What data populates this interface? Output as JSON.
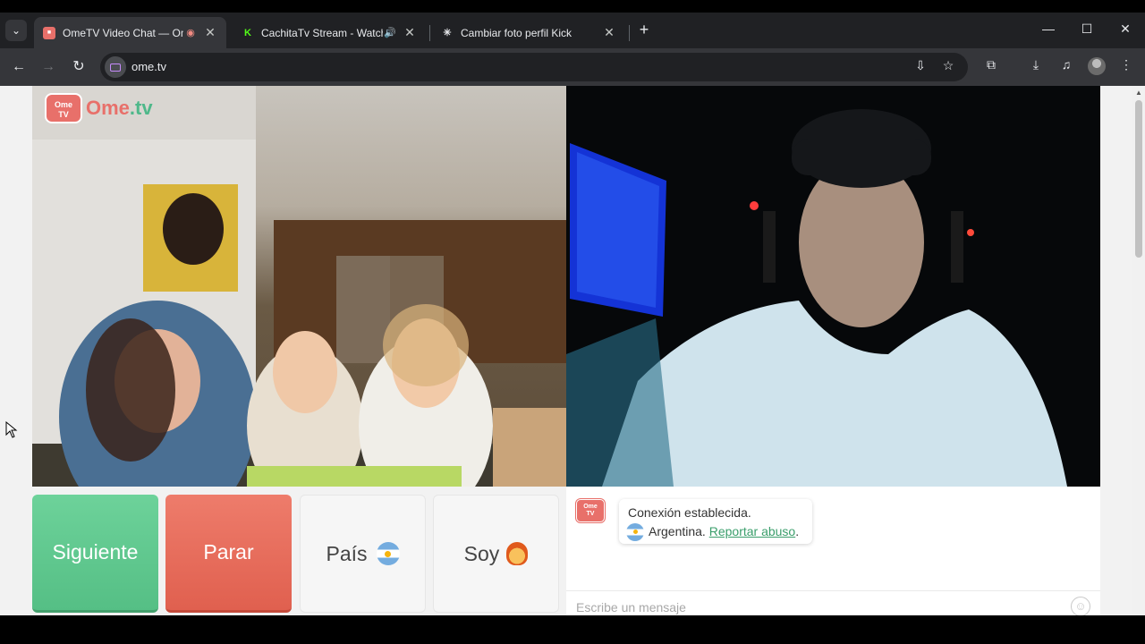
{
  "browser": {
    "tabs": [
      {
        "title": "OmeTV Video Chat — Ome",
        "favicon": "ometv-icon",
        "recording": true,
        "active": true
      },
      {
        "title": "CachitaTv Stream - Watch L",
        "favicon": "kick-icon",
        "audio": true,
        "active": false
      },
      {
        "title": "Cambiar foto perfil Kick",
        "favicon": "openai-icon",
        "active": false
      }
    ],
    "new_tab_label": "+",
    "url": "ome.tv"
  },
  "video": {
    "logo_top": "Ome",
    "logo_bottom": "TV",
    "logo_word_a": "Ome",
    "logo_word_b": ".tv"
  },
  "controls": {
    "next_label": "Siguiente",
    "stop_label": "Parar",
    "country_label": "País",
    "iam_label": "Soy"
  },
  "chat": {
    "logo_top": "Ome",
    "logo_bottom": "TV",
    "status": "Conexión establecida.",
    "country": "Argentina.",
    "report_link": "Reportar abuso",
    "report_suffix": ".",
    "input_placeholder": "Escribe un mensaje"
  },
  "colors": {
    "next": "#55bf85",
    "stop": "#e0604f",
    "brand": "#e8706a",
    "link": "#3a9e6b"
  }
}
